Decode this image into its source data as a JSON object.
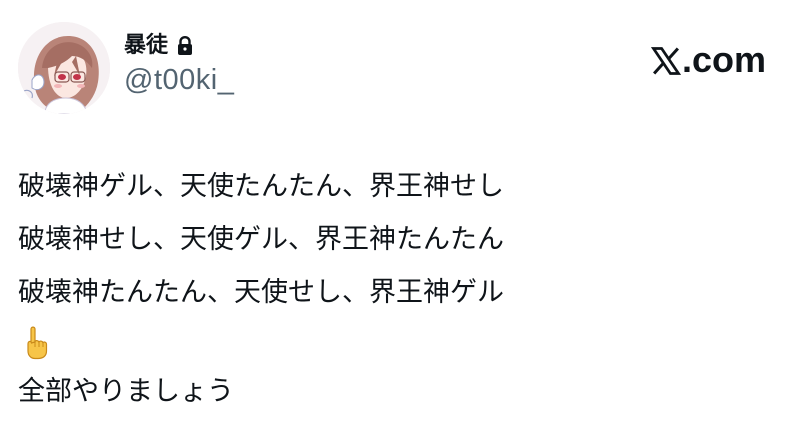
{
  "post": {
    "display_name": "暴徒",
    "handle": "@t00ki_",
    "brand": ".com",
    "lines": [
      "破壊神ゲル、天使たんたん、界王神せし",
      "破壊神せし、天使ゲル、界王神たんたん",
      "破壊神たんたん、天使せし、界王神ゲル"
    ],
    "emoji_icon": "pointing-up-hand-icon",
    "closing": "全部やりましょう"
  },
  "icons": {
    "lock": "lock-icon",
    "brand": "x-logo-icon"
  },
  "colors": {
    "text": "#0f1419",
    "secondary": "#536471",
    "background": "#ffffff"
  }
}
